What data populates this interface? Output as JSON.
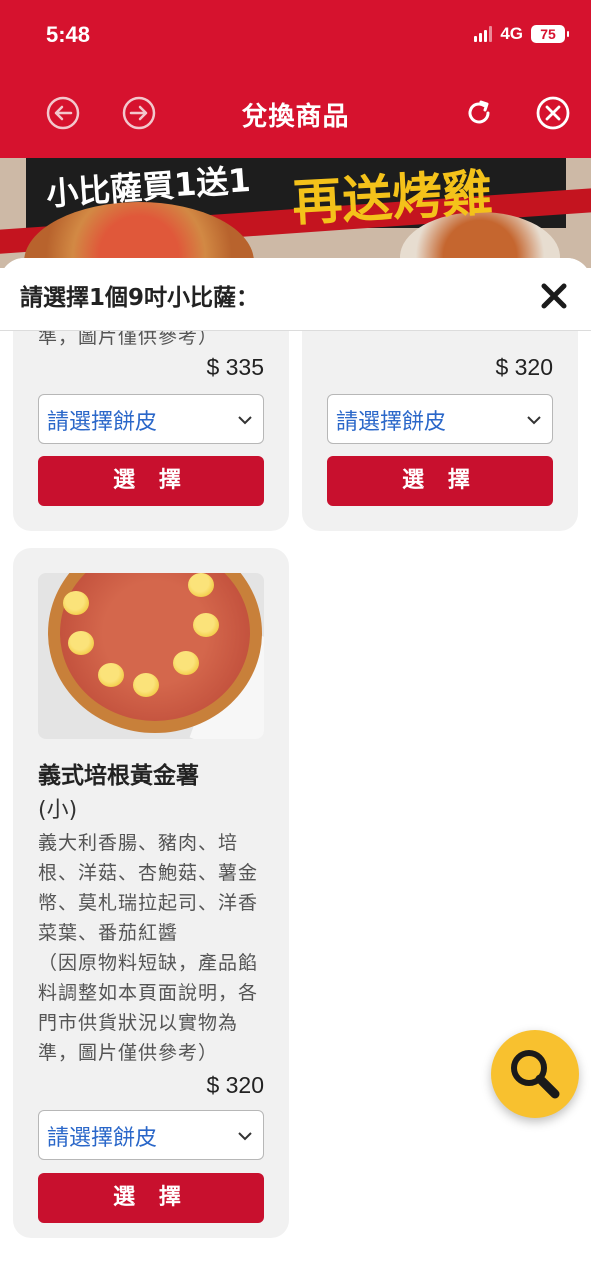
{
  "status_bar": {
    "time": "5:48",
    "network": "4G",
    "battery": "75"
  },
  "header": {
    "title": "兌換商品"
  },
  "banner": {
    "text_left": "小比薩買1送1",
    "text_right": "再送烤雞"
  },
  "sheet": {
    "title": "請選擇1個9吋小比薩："
  },
  "cards": [
    {
      "desc_tail": "準，圖片僅供參考）",
      "price": "$ 335",
      "crust_placeholder": "請選擇餅皮",
      "button": "選 擇"
    },
    {
      "price": "$ 320",
      "crust_placeholder": "請選擇餅皮",
      "button": "選 擇"
    },
    {
      "name": "義式培根黃金薯",
      "size": "(小)",
      "desc_lines": [
        "義大利香腸、豬肉、培",
        "根、洋菇、杏鮑菇、薯金",
        "幣、莫札瑞拉起司、洋香",
        "菜葉、番茄紅醬",
        "（因原物料短缺，產品餡",
        "料調整如本頁面說明，各",
        "門市供貨狀況以實物為",
        "準，圖片僅供參考）"
      ],
      "price": "$ 320",
      "crust_placeholder": "請選擇餅皮",
      "button": "選 擇"
    }
  ],
  "colors": {
    "brand_red": "#d6122e",
    "button_red": "#c8102e",
    "select_text": "#2a67c9",
    "fab_yellow": "#f8c12f"
  },
  "icons": {
    "back": "arrow-left-circle-icon",
    "forward": "arrow-right-circle-icon",
    "refresh": "refresh-icon",
    "close_header": "close-circle-icon",
    "close_sheet": "close-x-icon",
    "search": "search-icon",
    "chevron": "chevron-down-icon"
  }
}
